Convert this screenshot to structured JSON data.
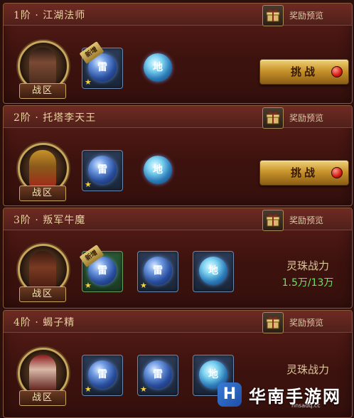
{
  "tiers": [
    {
      "title": "1阶 · 江湖法师",
      "preview": "奖励预览",
      "zone": "战区",
      "action": "挑战",
      "slots": [
        {
          "glyph": "雷",
          "badge": "新增",
          "kind": "blue"
        },
        {
          "glyph": "地",
          "kind": "cyan-plain"
        }
      ]
    },
    {
      "title": "2阶 · 托塔李天王",
      "preview": "奖励预览",
      "zone": "战区",
      "action": "挑战",
      "slots": [
        {
          "glyph": "雷",
          "kind": "blue"
        },
        {
          "glyph": "地",
          "kind": "cyan-plain"
        }
      ]
    },
    {
      "title": "3阶 · 叛军牛魔",
      "preview": "奖励预览",
      "zone": "战区",
      "power_label": "灵珠战力",
      "power_value": "1.5万/13万",
      "slots": [
        {
          "glyph": "雷",
          "badge": "新增",
          "kind": "green"
        },
        {
          "glyph": "雷",
          "kind": "blue"
        },
        {
          "glyph": "地",
          "kind": "cyan-plain"
        }
      ]
    },
    {
      "title": "4阶 · 蝎子精",
      "preview": "奖励预览",
      "zone": "战区",
      "power_label": "灵珠战力",
      "slots": [
        {
          "glyph": "雷",
          "kind": "blue"
        },
        {
          "glyph": "雷",
          "kind": "blue"
        },
        {
          "glyph": "地",
          "kind": "cyan-plain"
        }
      ]
    }
  ],
  "watermark": {
    "logo": "H",
    "name": "华南手游网",
    "url": "hnsadq.cc"
  },
  "colors": {
    "accent_gold": "#c9a55c",
    "power_green": "#6fe06a",
    "panel_red": "#5a1e18"
  }
}
